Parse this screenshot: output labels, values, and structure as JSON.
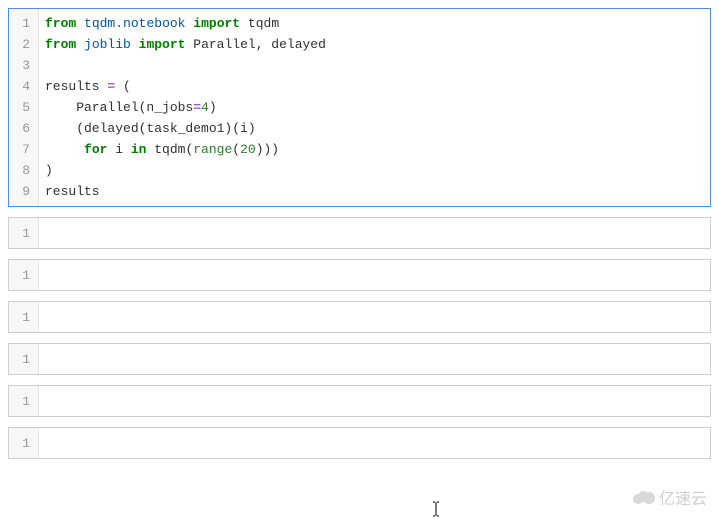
{
  "main_cell": {
    "lines": [
      {
        "n": "1",
        "tokens": [
          {
            "t": "from",
            "c": "tok-kw"
          },
          {
            "t": " ",
            "c": "tok-plain"
          },
          {
            "t": "tqdm",
            "c": "tok-mod"
          },
          {
            "t": ".",
            "c": "tok-mod"
          },
          {
            "t": "notebook",
            "c": "tok-mod"
          },
          {
            "t": " ",
            "c": "tok-plain"
          },
          {
            "t": "import",
            "c": "tok-kw"
          },
          {
            "t": " ",
            "c": "tok-plain"
          },
          {
            "t": "tqdm",
            "c": "tok-plain"
          }
        ]
      },
      {
        "n": "2",
        "tokens": [
          {
            "t": "from",
            "c": "tok-kw"
          },
          {
            "t": " ",
            "c": "tok-plain"
          },
          {
            "t": "joblib",
            "c": "tok-mod"
          },
          {
            "t": " ",
            "c": "tok-plain"
          },
          {
            "t": "import",
            "c": "tok-kw"
          },
          {
            "t": " ",
            "c": "tok-plain"
          },
          {
            "t": "Parallel, delayed",
            "c": "tok-plain"
          }
        ]
      },
      {
        "n": "3",
        "tokens": []
      },
      {
        "n": "4",
        "tokens": [
          {
            "t": "results ",
            "c": "tok-plain"
          },
          {
            "t": "=",
            "c": "tok-op"
          },
          {
            "t": " (",
            "c": "tok-plain"
          }
        ]
      },
      {
        "n": "5",
        "tokens": [
          {
            "t": "    Parallel(n_jobs",
            "c": "tok-plain"
          },
          {
            "t": "=",
            "c": "tok-op"
          },
          {
            "t": "4",
            "c": "tok-num"
          },
          {
            "t": ")",
            "c": "tok-plain"
          }
        ]
      },
      {
        "n": "6",
        "tokens": [
          {
            "t": "    (delayed(task_demo1)(i)",
            "c": "tok-plain"
          }
        ]
      },
      {
        "n": "7",
        "tokens": [
          {
            "t": "     ",
            "c": "tok-plain"
          },
          {
            "t": "for",
            "c": "tok-kw"
          },
          {
            "t": " i ",
            "c": "tok-plain"
          },
          {
            "t": "in",
            "c": "tok-kw"
          },
          {
            "t": " tqdm(",
            "c": "tok-plain"
          },
          {
            "t": "range",
            "c": "tok-fn"
          },
          {
            "t": "(",
            "c": "tok-plain"
          },
          {
            "t": "20",
            "c": "tok-num"
          },
          {
            "t": ")))",
            "c": "tok-plain"
          }
        ]
      },
      {
        "n": "8",
        "tokens": [
          {
            "t": ")",
            "c": "tok-plain"
          }
        ]
      },
      {
        "n": "9",
        "tokens": [
          {
            "t": "results",
            "c": "tok-plain"
          }
        ]
      }
    ]
  },
  "empty_cells": [
    {
      "n": "1"
    },
    {
      "n": "1"
    },
    {
      "n": "1"
    },
    {
      "n": "1"
    },
    {
      "n": "1"
    },
    {
      "n": "1"
    }
  ],
  "watermark": "亿速云"
}
